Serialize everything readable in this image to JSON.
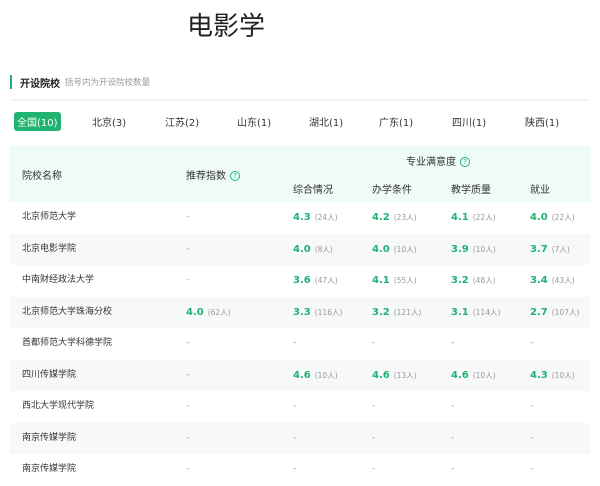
{
  "title": "电影学",
  "section": {
    "heading": "开设院校",
    "subtitle": "括号内为开设院校数量"
  },
  "tabs": [
    {
      "label": "全国(10)",
      "active": true
    },
    {
      "label": "北京(3)"
    },
    {
      "label": "江苏(2)"
    },
    {
      "label": "山东(1)"
    },
    {
      "label": "湖北(1)"
    },
    {
      "label": "广东(1)"
    },
    {
      "label": "四川(1)"
    },
    {
      "label": "陕西(1)"
    }
  ],
  "table": {
    "headers": {
      "name": "院校名称",
      "recommend": "推荐指数",
      "satisfaction": "专业满意度",
      "overall": "综合情况",
      "conditions": "办学条件",
      "quality": "教学质量",
      "employment": "就业"
    },
    "rows": [
      {
        "name": "北京师范大学",
        "rec": "-",
        "rec_n": "",
        "c": [
          [
            "4.3",
            "(24人)"
          ],
          [
            "4.2",
            "(23人)"
          ],
          [
            "4.1",
            "(22人)"
          ],
          [
            "4.0",
            "(22人)"
          ]
        ]
      },
      {
        "name": "北京电影学院",
        "rec": "-",
        "rec_n": "",
        "c": [
          [
            "4.0",
            "(8人)"
          ],
          [
            "4.0",
            "(10人)"
          ],
          [
            "3.9",
            "(10人)"
          ],
          [
            "3.7",
            "(7人)"
          ]
        ]
      },
      {
        "name": "中南财经政法大学",
        "rec": "-",
        "rec_n": "",
        "c": [
          [
            "3.6",
            "(47人)"
          ],
          [
            "4.1",
            "(55人)"
          ],
          [
            "3.2",
            "(48人)"
          ],
          [
            "3.4",
            "(43人)"
          ]
        ]
      },
      {
        "name": "北京师范大学珠海分校",
        "rec": "4.0",
        "rec_n": "(62人)",
        "c": [
          [
            "3.3",
            "(116人)"
          ],
          [
            "3.2",
            "(121人)"
          ],
          [
            "3.1",
            "(114人)"
          ],
          [
            "2.7",
            "(107人)"
          ]
        ]
      },
      {
        "name": "首都师范大学科德学院",
        "rec": "-",
        "rec_n": "",
        "c": [
          [
            "-",
            ""
          ],
          [
            "-",
            ""
          ],
          [
            "-",
            ""
          ],
          [
            "-",
            ""
          ]
        ]
      },
      {
        "name": "四川传媒学院",
        "rec": "-",
        "rec_n": "",
        "c": [
          [
            "4.6",
            "(10人)"
          ],
          [
            "4.6",
            "(13人)"
          ],
          [
            "4.6",
            "(10人)"
          ],
          [
            "4.3",
            "(10人)"
          ]
        ]
      },
      {
        "name": "西北大学现代学院",
        "rec": "-",
        "rec_n": "",
        "c": [
          [
            "-",
            ""
          ],
          [
            "-",
            ""
          ],
          [
            "-",
            ""
          ],
          [
            "-",
            ""
          ]
        ]
      },
      {
        "name": "南京传媒学院",
        "rec": "-",
        "rec_n": "",
        "c": [
          [
            "-",
            ""
          ],
          [
            "-",
            ""
          ],
          [
            "-",
            ""
          ],
          [
            "-",
            ""
          ]
        ]
      },
      {
        "name": "南京传媒学院",
        "rec": "-",
        "rec_n": "",
        "c": [
          [
            "-",
            ""
          ],
          [
            "-",
            ""
          ],
          [
            "-",
            ""
          ],
          [
            "-",
            ""
          ]
        ]
      }
    ]
  },
  "colors": {
    "accent": "#1fb36f"
  }
}
